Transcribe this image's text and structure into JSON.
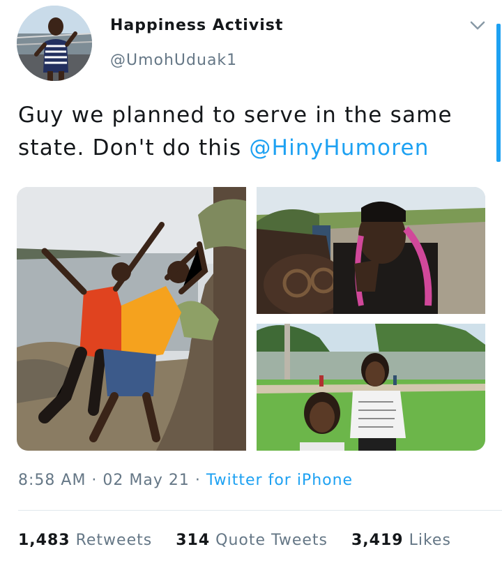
{
  "tweet": {
    "display_name": "Happiness Activist",
    "handle": "@UmohUduak1",
    "text_before": "Guy we planned to serve in the same state. Don't do this ",
    "mention": "@HinyHumoren",
    "timestamp": "8:58 AM · 02 May 21 · ",
    "source": "Twitter for iPhone"
  },
  "icons": {
    "more": "chevron-down-icon"
  },
  "stats": {
    "retweets_count": "1,483",
    "retweets_label": "Retweets",
    "quotes_count": "314",
    "quotes_label": "Quote Tweets",
    "likes_count": "3,419",
    "likes_label": "Likes"
  },
  "colors": {
    "accent": "#1da1f2",
    "secondary_text": "#657786",
    "primary_text": "#14171a",
    "divider": "#e1e8ed"
  }
}
